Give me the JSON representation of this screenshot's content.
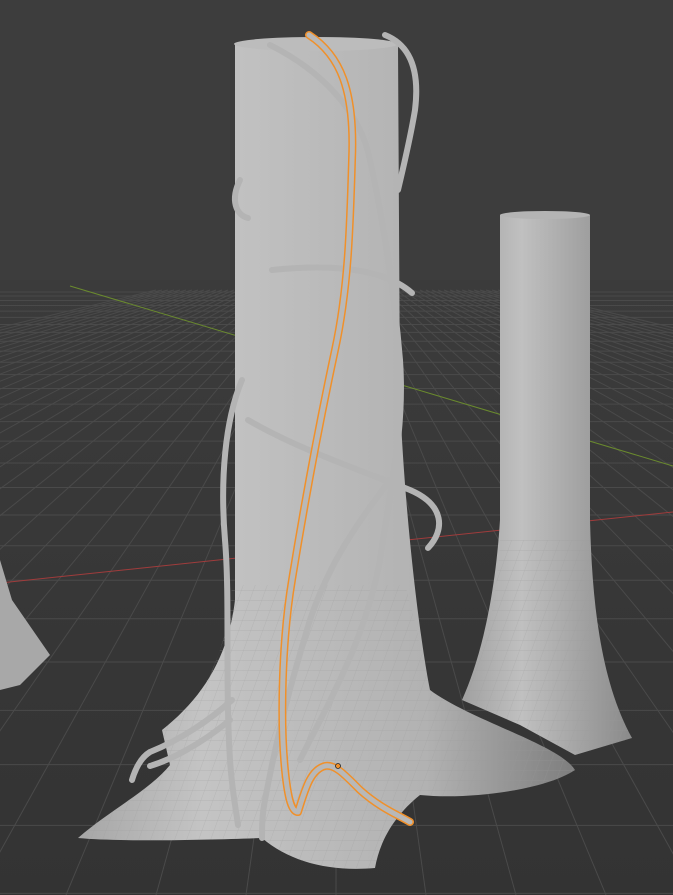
{
  "viewport": {
    "mode": "object",
    "shading": "solid",
    "background_color": "#3d3d3d"
  },
  "colors": {
    "grid_line": "#4a4a4a",
    "axis_x": "#a03c3c",
    "axis_y": "#6a8a2e",
    "mesh_light": "#c2c2c2",
    "mesh_mid": "#a8a8a8",
    "mesh_dark": "#8c8c8c",
    "vine": "#b0b0b0",
    "selection_outline": "#f0902a"
  },
  "scene": {
    "objects": [
      {
        "name": "trunk-large",
        "type": "mesh",
        "selected": false
      },
      {
        "name": "trunk-small",
        "type": "mesh",
        "selected": false
      },
      {
        "name": "trunk-offscreen-left",
        "type": "mesh",
        "selected": false
      },
      {
        "name": "vine-curves",
        "type": "curve",
        "selected": false
      },
      {
        "name": "vine-active",
        "type": "curve",
        "selected": true
      }
    ]
  }
}
